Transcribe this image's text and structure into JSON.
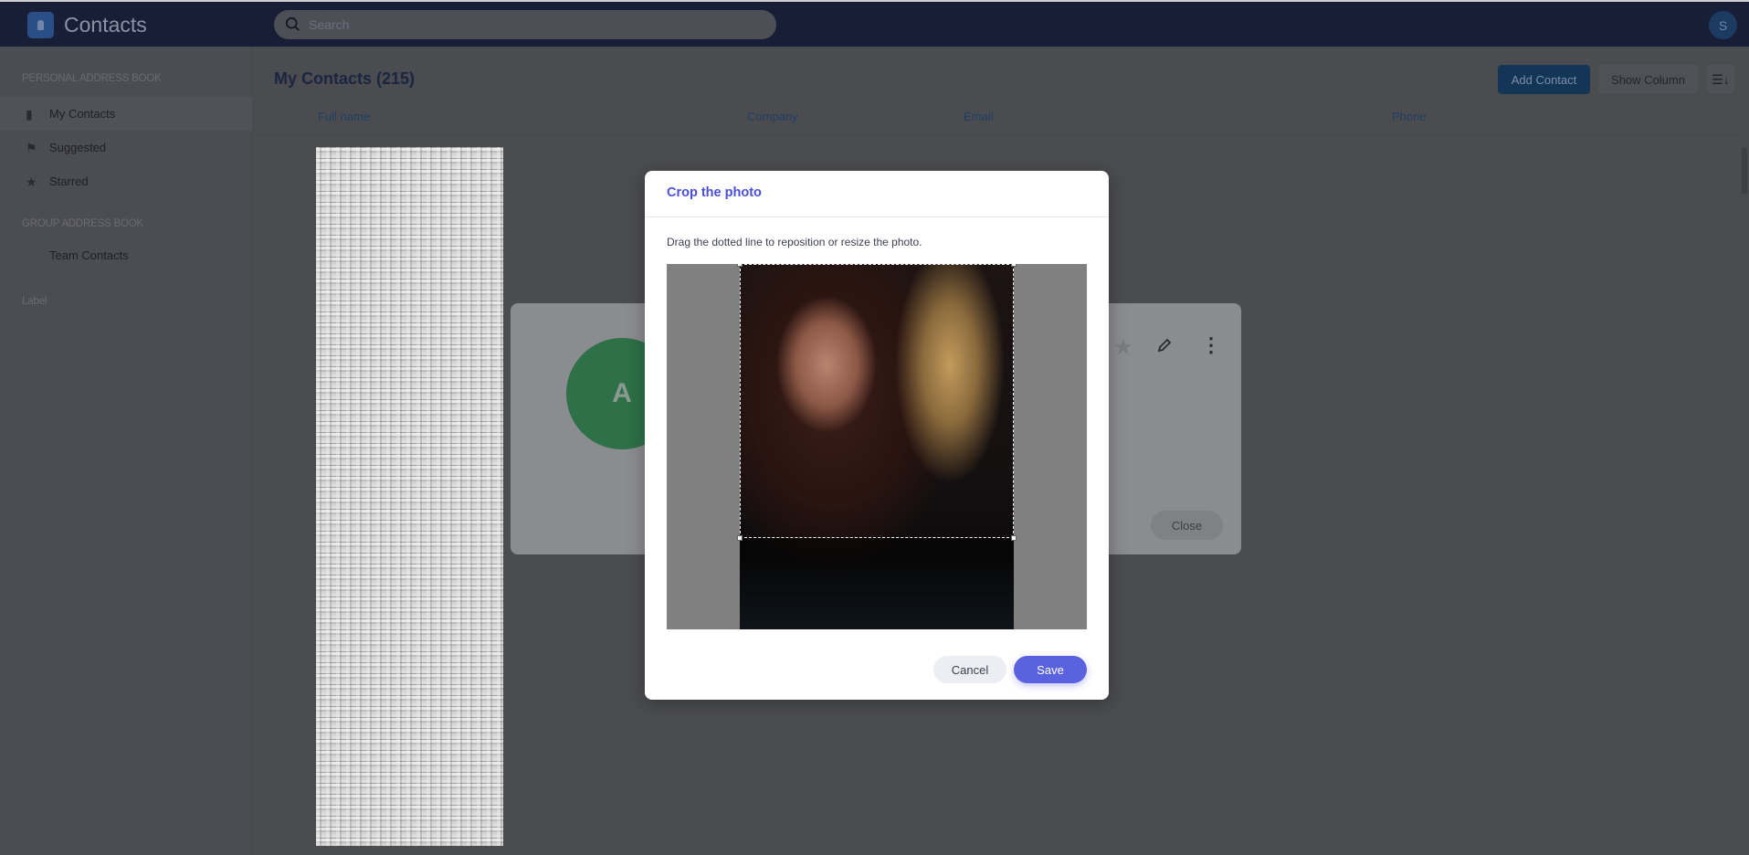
{
  "header": {
    "app_title": "Contacts",
    "search_placeholder": "Search",
    "user_initial": "S"
  },
  "sidebar": {
    "personal_section": "PERSONAL ADDRESS BOOK",
    "items": [
      {
        "label": "My Contacts",
        "icon": "book-icon",
        "active": true
      },
      {
        "label": "Suggested",
        "icon": "flag-icon"
      },
      {
        "label": "Starred",
        "icon": "star-icon"
      }
    ],
    "group_section": "GROUP ADDRESS BOOK",
    "group_items": [
      {
        "label": "Team Contacts"
      }
    ],
    "label_section": "Label"
  },
  "main": {
    "title": "My Contacts (215)",
    "add_contact": "Add Contact",
    "show_column": "Show Column",
    "columns": [
      "Full name",
      "Company",
      "Email",
      "Phone"
    ]
  },
  "contact_card": {
    "avatar_initial": "A",
    "avatar_color": "#34a853",
    "close": "Close"
  },
  "dialog": {
    "title": "Crop the photo",
    "instruction": "Drag the dotted line to reposition or resize the photo.",
    "cancel": "Cancel",
    "save": "Save",
    "accent": "#5a62e0"
  }
}
